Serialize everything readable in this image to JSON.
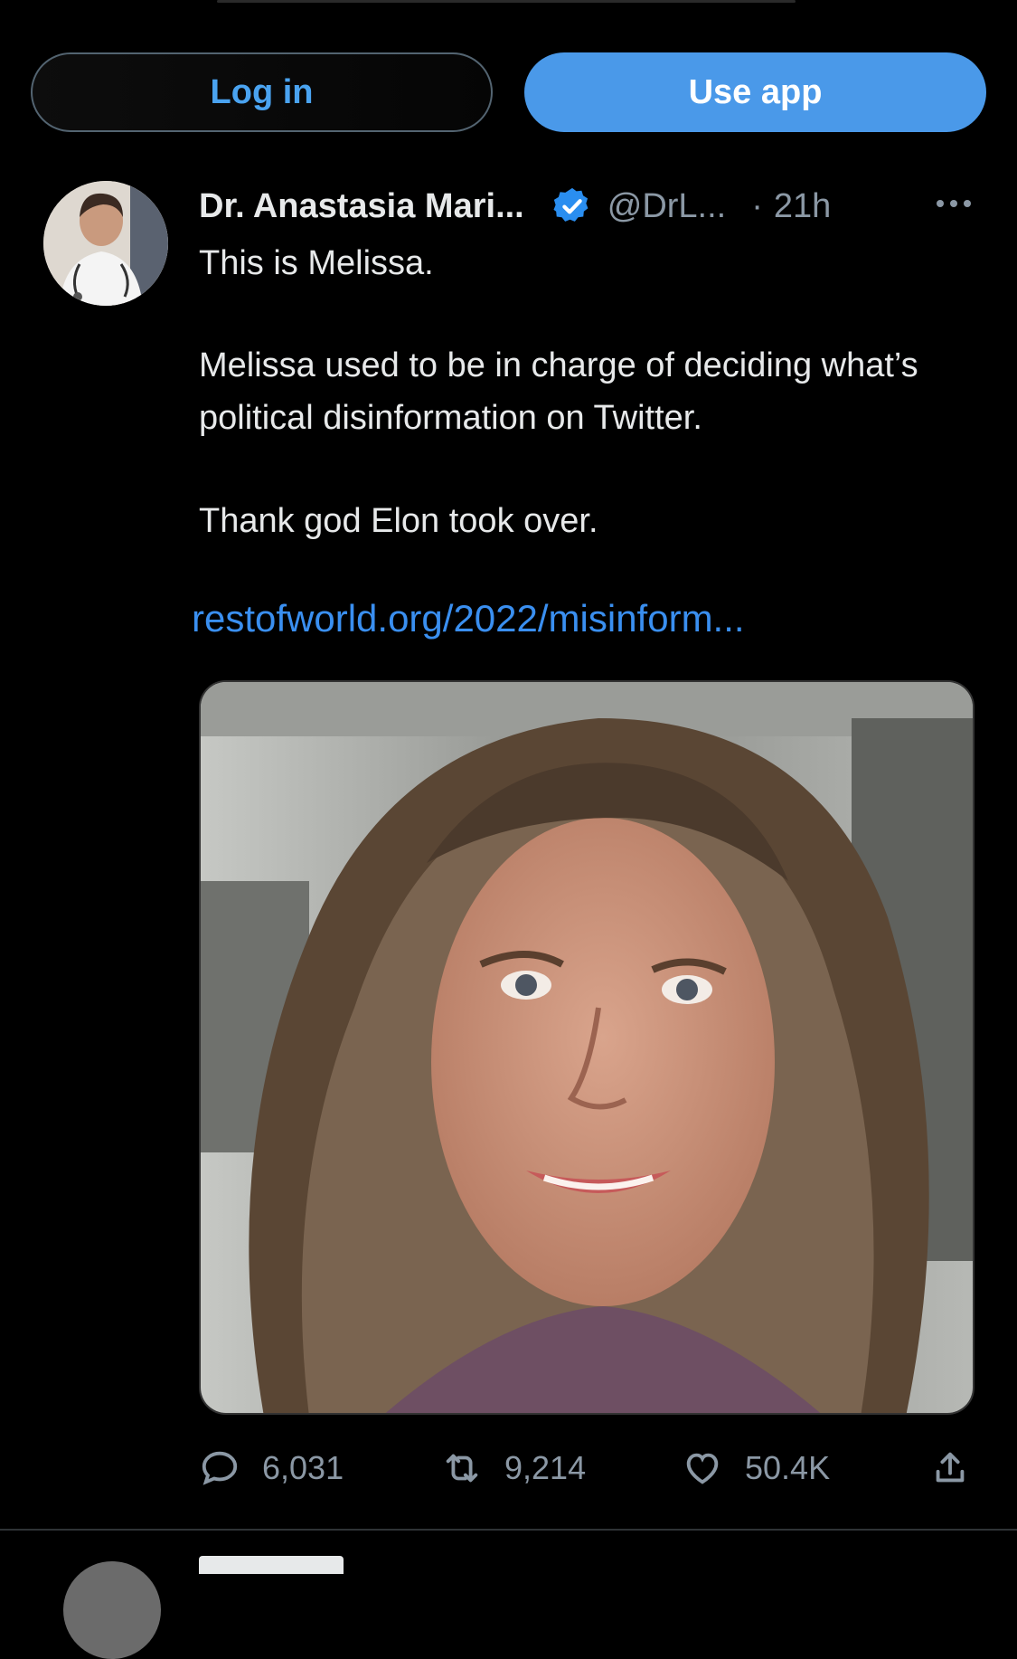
{
  "top_bar": {
    "login_label": "Log in",
    "use_app_label": "Use app"
  },
  "tweet": {
    "author_name": "Dr. Anastasia Mari...",
    "handle": "@DrL...",
    "separator": "·",
    "time": "21h",
    "paragraphs": [
      "This is Melissa.",
      "Melissa used to be in charge of deciding what’s political disinformation on Twitter.",
      "Thank god Elon took over."
    ],
    "link_text": "restofworld.org/2022/misinform...",
    "stats": {
      "replies": "6,031",
      "retweets": "9,214",
      "likes": "50.4K"
    }
  },
  "icons": {
    "verified": "verified-badge-icon",
    "more": "more-options-icon",
    "reply": "reply-icon",
    "retweet": "retweet-icon",
    "like": "heart-icon",
    "share": "share-icon"
  },
  "colors": {
    "background": "#000000",
    "accent": "#4a99e9",
    "link": "#3a8ff0",
    "muted": "#8b98a5"
  }
}
